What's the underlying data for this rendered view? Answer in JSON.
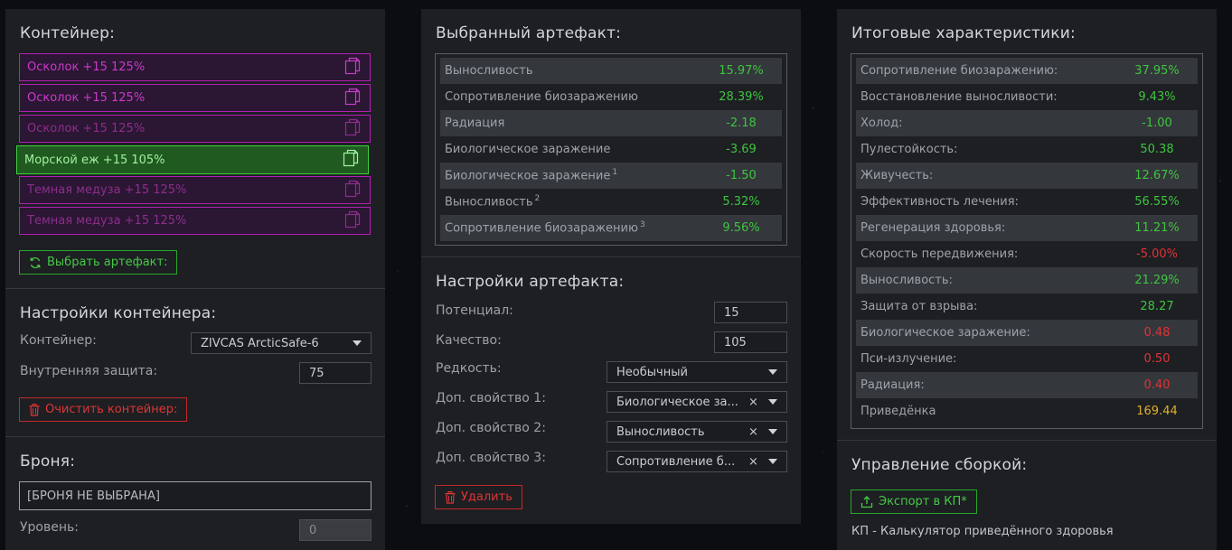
{
  "container": {
    "title": "Контейнер:",
    "slots": [
      {
        "label": "Осколок +15 125%",
        "state": "bright"
      },
      {
        "label": "Осколок +15 125%",
        "state": "bright"
      },
      {
        "label": "Осколок +15 125%",
        "state": "dim"
      },
      {
        "label": "Морской еж +15 105%",
        "state": "selected"
      },
      {
        "label": "Темная медуза +15 125%",
        "state": "dim"
      },
      {
        "label": "Темная медуза +15 125%",
        "state": "dim"
      }
    ],
    "select_button": "Выбрать артефакт:"
  },
  "container_settings": {
    "title": "Настройки контейнера:",
    "container_label": "Контейнер:",
    "container_value": "ZIVCAS ArcticSafe-6",
    "protection_label": "Внутренняя защита:",
    "protection_value": "75",
    "clear_button": "Очистить контейнер:"
  },
  "armor": {
    "title": "Броня:",
    "value": "[БРОНЯ НЕ ВЫБРАНА]",
    "level_label": "Уровень:",
    "level_value": "0"
  },
  "selected_artifact": {
    "title": "Выбранный артефакт:",
    "stats": [
      {
        "name": "Выносливость",
        "sup": "",
        "value": "15.97%",
        "tone": "pos"
      },
      {
        "name": "Сопротивление биозаражению",
        "sup": "",
        "value": "28.39%",
        "tone": "pos"
      },
      {
        "name": "Радиация",
        "sup": "",
        "value": "-2.18",
        "tone": "pos"
      },
      {
        "name": "Биологическое заражение",
        "sup": "",
        "value": "-3.69",
        "tone": "pos"
      },
      {
        "name": "Биологическое заражение",
        "sup": "1",
        "value": "-1.50",
        "tone": "pos"
      },
      {
        "name": "Выносливость",
        "sup": "2",
        "value": "5.32%",
        "tone": "pos"
      },
      {
        "name": "Сопротивление биозаражению",
        "sup": "3",
        "value": "9.56%",
        "tone": "pos"
      }
    ]
  },
  "artifact_settings": {
    "title": "Настройки артефакта:",
    "potential_label": "Потенциал:",
    "potential_value": "15",
    "quality_label": "Качество:",
    "quality_value": "105",
    "rarity_label": "Редкость:",
    "rarity_value": "Необычный",
    "extra1_label": "Доп. свойство 1:",
    "extra1_value": "Биологическое за...",
    "extra2_label": "Доп. свойство 2:",
    "extra2_value": "Выносливость",
    "extra3_label": "Доп. свойство 3:",
    "extra3_value": "Сопротивление б...",
    "clear_symbol": "×",
    "delete_button": "Удалить"
  },
  "totals": {
    "title": "Итоговые характеристики:",
    "stats": [
      {
        "name": "Сопротивление биозаражению:",
        "value": "37.95%",
        "tone": "pos"
      },
      {
        "name": "Восстановление выносливости:",
        "value": "9.43%",
        "tone": "pos"
      },
      {
        "name": "Холод:",
        "value": "-1.00",
        "tone": "pos"
      },
      {
        "name": "Пулестойкость:",
        "value": "50.38",
        "tone": "pos"
      },
      {
        "name": "Живучесть:",
        "value": "12.67%",
        "tone": "pos"
      },
      {
        "name": "Эффективность лечения:",
        "value": "56.55%",
        "tone": "pos"
      },
      {
        "name": "Регенерация здоровья:",
        "value": "11.21%",
        "tone": "pos"
      },
      {
        "name": "Скорость передвижения:",
        "value": "-5.00%",
        "tone": "neg"
      },
      {
        "name": "Выносливость:",
        "value": "21.29%",
        "tone": "pos"
      },
      {
        "name": "Защита от взрыва:",
        "value": "28.27",
        "tone": "pos"
      },
      {
        "name": "Биологическое заражение:",
        "value": "0.48",
        "tone": "neg"
      },
      {
        "name": "Пси-излучение:",
        "value": "0.50",
        "tone": "neg"
      },
      {
        "name": "Радиация:",
        "value": "0.40",
        "tone": "neg"
      },
      {
        "name": "Приведёнка",
        "value": "169.44",
        "tone": "gold"
      }
    ]
  },
  "build": {
    "title": "Управление сборкой:",
    "export_button": "Экспорт в КП*",
    "footnote": "КП - Калькулятор приведённого здоровья"
  },
  "colors": {
    "panel_bg": "#1d1f23",
    "positive": "#3fc43f",
    "negative": "#e23333",
    "gold": "#e0b02a",
    "slot_border": "#b51fb5",
    "selected_border": "#3ed13e"
  },
  "icons": {
    "copy": "copy-icon",
    "refresh": "refresh-icon",
    "trash": "trash-icon",
    "export": "export-icon",
    "dropdown": "chevron-down-icon"
  }
}
